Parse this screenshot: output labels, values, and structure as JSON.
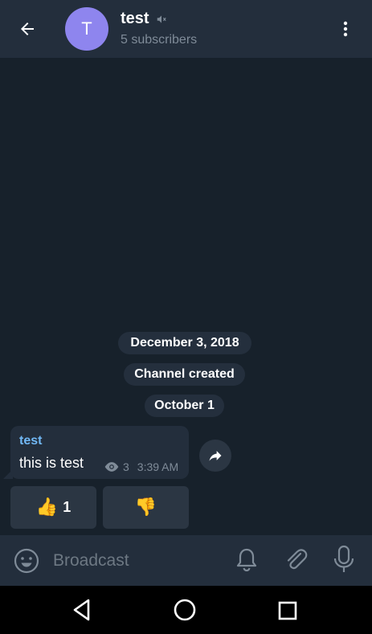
{
  "header": {
    "back_icon": "arrow-left-icon",
    "avatar_letter": "T",
    "avatar_color": "#8e85ee",
    "title": "test",
    "muted_icon": "muted-speaker-icon",
    "subtitle": "5 subscribers",
    "menu_icon": "more-vertical-icon"
  },
  "chat": {
    "date_chip_1": "December 3, 2018",
    "service_message": "Channel created",
    "date_chip_2": "October 1",
    "message": {
      "author": "test",
      "text": "this is test",
      "views": "3",
      "time": "3:39 AM",
      "author_color": "#71b8f5"
    },
    "share_icon": "share-arrow-icon",
    "reactions": [
      {
        "emoji": "👍",
        "count": "1"
      },
      {
        "emoji": "👎",
        "count": ""
      }
    ]
  },
  "input_bar": {
    "emoji_icon": "smile-icon",
    "placeholder": "Broadcast",
    "bell_icon": "bell-icon",
    "attach_icon": "paperclip-icon",
    "mic_icon": "microphone-icon"
  },
  "nav_bar": {
    "back_icon": "nav-back-triangle-icon",
    "home_icon": "nav-home-circle-icon",
    "recents_icon": "nav-recents-square-icon"
  },
  "colors": {
    "background": "#17212b",
    "header": "#232e3c",
    "bubble": "#232e3c",
    "chip": "#242f3d"
  }
}
